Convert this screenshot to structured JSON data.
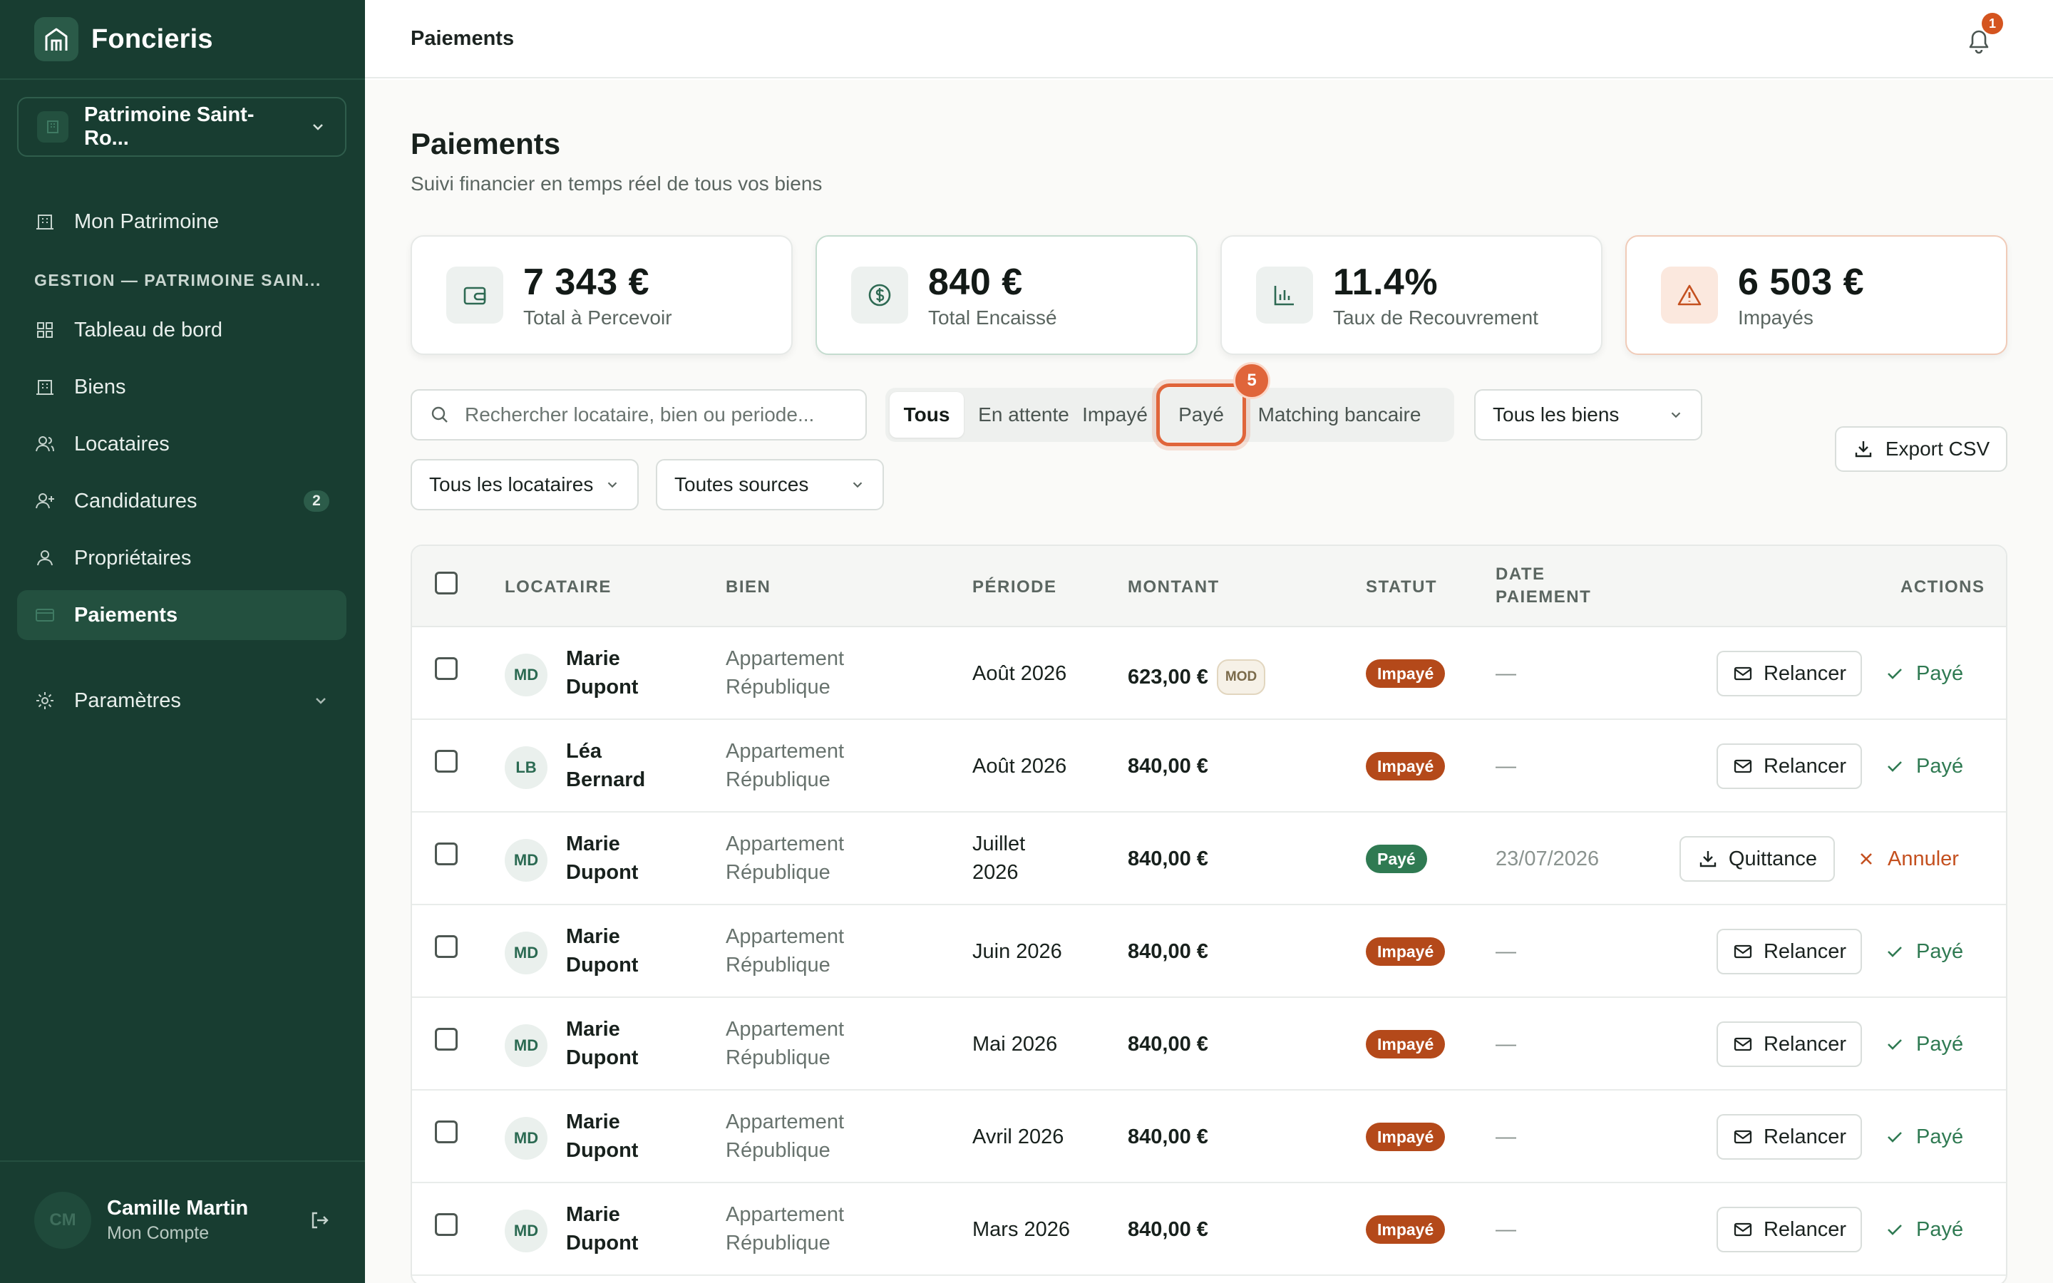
{
  "app": {
    "name": "Foncieris"
  },
  "sidebar": {
    "org": "Patrimoine Saint-Ro...",
    "items": [
      {
        "label": "Mon Patrimoine"
      },
      {
        "label": "Tableau de bord"
      },
      {
        "label": "Biens"
      },
      {
        "label": "Locataires"
      },
      {
        "label": "Candidatures",
        "badge": "2"
      },
      {
        "label": "Propriétaires"
      },
      {
        "label": "Paiements"
      },
      {
        "label": "Paramètres"
      }
    ],
    "section": "GESTION — PATRIMOINE SAIN...",
    "user": {
      "initials": "CM",
      "name": "Camille Martin",
      "sub": "Mon Compte"
    }
  },
  "header": {
    "title": "Paiements",
    "notifications": "1"
  },
  "page": {
    "title": "Paiements",
    "subtitle": "Suivi financier en temps réel de tous vos biens"
  },
  "stats": [
    {
      "value": "7 343 €",
      "label": "Total à Percevoir",
      "icon": "wallet-icon"
    },
    {
      "value": "840 €",
      "label": "Total Encaissé",
      "icon": "dollar-circle-icon"
    },
    {
      "value": "11.4%",
      "label": "Taux de Recouvrement",
      "icon": "bar-chart-icon"
    },
    {
      "value": "6 503 €",
      "label": "Impayés",
      "icon": "warning-icon"
    }
  ],
  "filters": {
    "search_placeholder": "Rechercher locataire, bien ou periode...",
    "tabs": [
      "Tous",
      "En attente",
      "Impayé",
      "Payé",
      "Matching bancaire"
    ],
    "active_tab": "Tous",
    "highlight_badge": "5",
    "biens": "Tous les biens",
    "locataires": "Tous les locataires",
    "sources": "Toutes sources",
    "export": "Export CSV"
  },
  "table": {
    "headers": {
      "tenant": "LOCATAIRE",
      "property": "BIEN",
      "period": "PÉRIODE",
      "amount": "MONTANT",
      "status": "STATUT",
      "date_line1": "DATE",
      "date_line2": "PAIEMENT",
      "actions": "ACTIONS"
    },
    "rows": [
      {
        "initials": "MD",
        "first": "Marie",
        "last": "Dupont",
        "prop1": "Appartement",
        "prop2": "République",
        "period": "Août 2026",
        "amount": "623,00 €",
        "mod": "MOD",
        "status": "Impayé",
        "date": "—",
        "action": "Relancer",
        "link": "Payé"
      },
      {
        "initials": "LB",
        "first": "Léa",
        "last": "Bernard",
        "prop1": "Appartement",
        "prop2": "République",
        "period": "Août 2026",
        "amount": "840,00 €",
        "status": "Impayé",
        "date": "—",
        "action": "Relancer",
        "link": "Payé"
      },
      {
        "initials": "MD",
        "first": "Marie",
        "last": "Dupont",
        "prop1": "Appartement",
        "prop2": "République",
        "period1": "Juillet",
        "period2": "2026",
        "amount": "840,00 €",
        "status": "Payé",
        "date": "23/07/2026",
        "action": "Quittance",
        "link": "Annuler"
      },
      {
        "initials": "MD",
        "first": "Marie",
        "last": "Dupont",
        "prop1": "Appartement",
        "prop2": "République",
        "period": "Juin 2026",
        "amount": "840,00 €",
        "status": "Impayé",
        "date": "—",
        "action": "Relancer",
        "link": "Payé"
      },
      {
        "initials": "MD",
        "first": "Marie",
        "last": "Dupont",
        "prop1": "Appartement",
        "prop2": "République",
        "period": "Mai 2026",
        "amount": "840,00 €",
        "status": "Impayé",
        "date": "—",
        "action": "Relancer",
        "link": "Payé"
      },
      {
        "initials": "MD",
        "first": "Marie",
        "last": "Dupont",
        "prop1": "Appartement",
        "prop2": "République",
        "period": "Avril 2026",
        "amount": "840,00 €",
        "status": "Impayé",
        "date": "—",
        "action": "Relancer",
        "link": "Payé"
      },
      {
        "initials": "MD",
        "first": "Marie",
        "last": "Dupont",
        "prop1": "Appartement",
        "prop2": "République",
        "period": "Mars 2026",
        "amount": "840,00 €",
        "status": "Impayé",
        "date": "—",
        "action": "Relancer",
        "link": "Payé"
      }
    ]
  },
  "colors": {
    "sidebar": "#183d31",
    "accent": "#2f7a52",
    "danger": "#b4491a",
    "highlight": "#e0653a"
  }
}
